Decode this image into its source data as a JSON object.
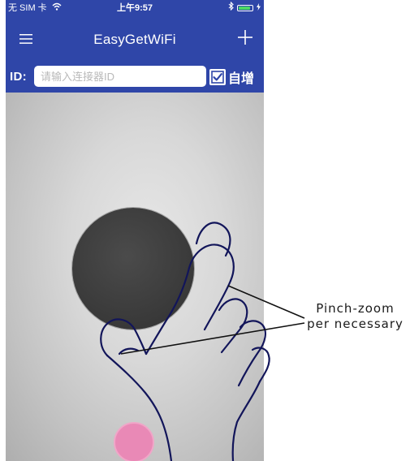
{
  "status_bar": {
    "carrier": "无 SIM 卡",
    "wifi_icon": "wifi-icon",
    "time": "上午9:57",
    "bluetooth_icon": "bluetooth-icon",
    "battery_icon": "battery-icon",
    "battery_level": 0.85
  },
  "nav": {
    "title": "EasyGetWiFi",
    "menu_icon": "hamburger-menu-icon",
    "add_icon": "plus-icon"
  },
  "id_bar": {
    "label": "ID:",
    "input_value": "",
    "input_placeholder": "请输入连接器ID",
    "auto_increment_label": "自增",
    "auto_increment_checked": true
  },
  "camera": {
    "target": "dark-circle-target",
    "capture_button_color": "#e989b6"
  },
  "annotation": {
    "line1": "Pinch-zoom",
    "line2": "per necessary",
    "hand_icon": "pinch-hand-icon"
  },
  "colors": {
    "brand": "#2f46a8",
    "capture": "#e989b6"
  }
}
